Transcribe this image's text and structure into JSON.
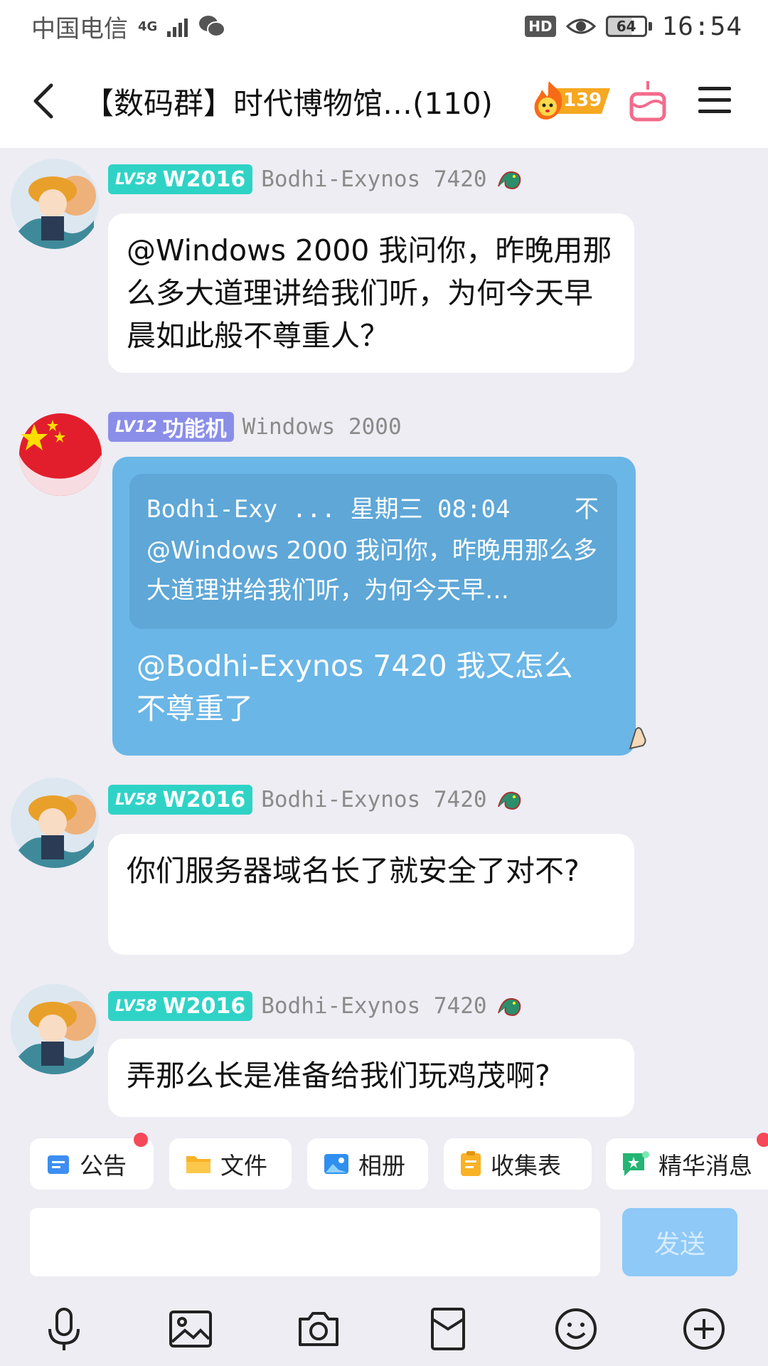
{
  "status": {
    "carrier": "中国电信",
    "network": "4G",
    "hd": "HD",
    "battery": "64",
    "time": "16:54"
  },
  "header": {
    "title": "【数码群】时代博物馆…(110)",
    "fire_count": "139"
  },
  "messages": [
    {
      "level": "LV58",
      "title_badge": "W2016",
      "sender": "Bodhi-Exynos 7420",
      "text": "@Windows 2000 我问你，昨晚用那么多大道理讲给我们听，为何今天早晨如此般不尊重人？"
    },
    {
      "level": "LV12",
      "title_badge": "功能机",
      "sender": "Windows 2000",
      "quote_header": "Bodhi-Exy ... 星期三 08:04",
      "quote_close": "不",
      "quote_text": "@Windows 2000 我问你，昨晚用那么多大道理讲给我们听，为何今天早…",
      "text": "@Bodhi-Exynos 7420 我又怎么不尊重了"
    },
    {
      "level": "LV58",
      "title_badge": "W2016",
      "sender": "Bodhi-Exynos 7420",
      "text": "你们服务器域名长了就安全了对不?"
    },
    {
      "level": "LV58",
      "title_badge": "W2016",
      "sender": "Bodhi-Exynos 7420",
      "text": "弄那么长是准备给我们玩鸡茂啊?"
    }
  ],
  "toolbar": {
    "announcement": "公告",
    "files": "文件",
    "album": "相册",
    "form": "收集表",
    "featured": "精华消息"
  },
  "input": {
    "placeholder": "",
    "send": "发送"
  },
  "colors": {
    "teal_badge": "#2fd3c6",
    "purple_badge": "#8b8ee8",
    "blue_bubble": "#6ab6e6",
    "send_button": "#8ec9f7"
  }
}
